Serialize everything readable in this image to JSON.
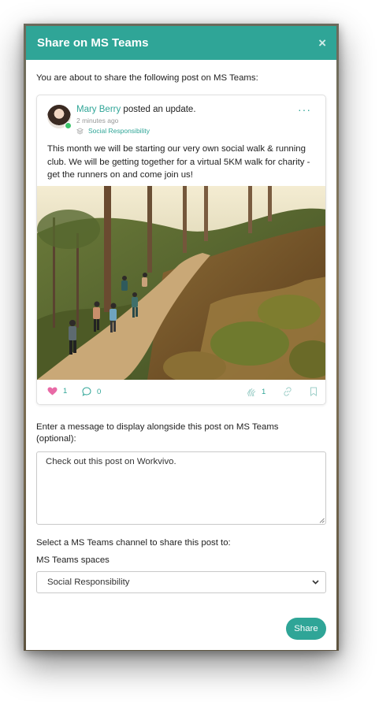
{
  "modal": {
    "title": "Share on MS Teams",
    "close_symbol": "×",
    "intro_text": "You are about to share the following post on MS Teams:"
  },
  "post": {
    "author_name": "Mary Berry",
    "action_text": " posted an update.",
    "time_ago": "2 minutes ago",
    "space_name": "Social Responsibility",
    "more_symbol": "···",
    "body": "This month we will be starting our very own social walk & running club. We will be getting together for a virtual 5KM walk for charity - get the runners on and come join us!",
    "likes_count": "1",
    "comments_count": "0",
    "claps_count": "1"
  },
  "form": {
    "message_label": "Enter a message to display alongside this post on MS Teams (optional):",
    "message_value": "Check out this post on Workvivo.",
    "channel_label": "Select a MS Teams channel to share this post to:",
    "spaces_label": "MS Teams spaces",
    "selected_space": "Social Responsibility",
    "share_label": "Share"
  },
  "colors": {
    "accent": "#2fa597",
    "heart": "#e86aa6",
    "online": "#3cc46a"
  },
  "icons": [
    "close-icon",
    "layers-icon",
    "more-icon",
    "heart-icon",
    "comment-icon",
    "clap-icon",
    "link-icon",
    "bookmark-icon",
    "chevron-down-icon"
  ]
}
